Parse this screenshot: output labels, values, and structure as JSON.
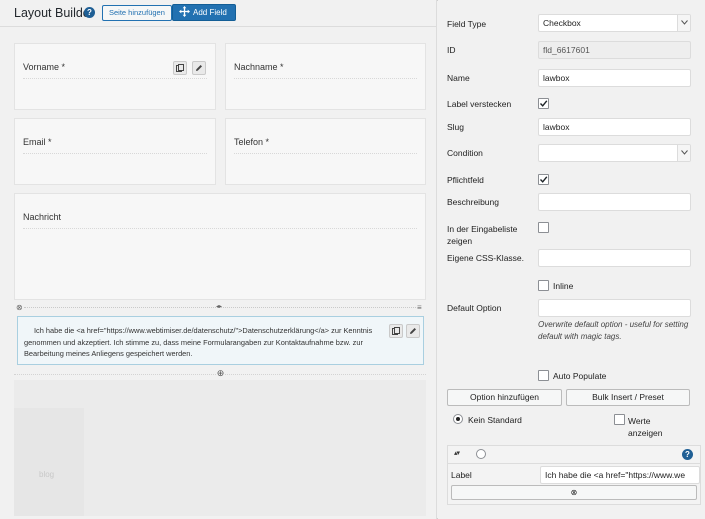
{
  "builder": {
    "title": "Layout Builder",
    "help": "?",
    "add_page_label": "Seite hinzufügen",
    "add_field_label": "Add Field",
    "fields": {
      "vorname": "Vorname *",
      "nachname": "Nachname *",
      "email": "Email *",
      "telefon": "Telefon *",
      "nachricht": "Nachricht"
    },
    "row_bar": {
      "remove": "⊗",
      "resize": "◂▸",
      "menu": "≡"
    },
    "consent_text": "Ich habe die <a href=\"https://www.webtimiser.de/datenschutz/\">Datenschutzerklärung</a> zur Kenntnis genommen und akzeptiert. Ich stimme zu, dass meine Formularangaben zur Kontaktaufnahme bzw. zur Bearbeitung meines Anliegens gespeichert werden.",
    "add_row_icon": "⊕",
    "page_placeholder": "blog"
  },
  "settings": {
    "field_type": {
      "label": "Field Type",
      "value": "Checkbox"
    },
    "id": {
      "label": "ID",
      "value": "fld_6617601"
    },
    "name": {
      "label": "Name",
      "value": "lawbox"
    },
    "hide_label": {
      "label": "Label verstecken",
      "checked": true
    },
    "slug": {
      "label": "Slug",
      "value": "lawbox"
    },
    "condition": {
      "label": "Condition",
      "value": ""
    },
    "required": {
      "label": "Pflichtfeld",
      "checked": true
    },
    "description": {
      "label": "Beschreibung",
      "value": ""
    },
    "entry_list": {
      "label_line1": "In der Eingabeliste",
      "label_line2": "zeigen",
      "checked": false
    },
    "css_class": {
      "label": "Eigene CSS-Klasse.",
      "value": ""
    },
    "inline": {
      "label": "Inline",
      "checked": false
    },
    "default_option": {
      "label": "Default Option",
      "value": "",
      "hint": "Overwrite default option - useful for setting default with magic tags."
    },
    "auto_populate": {
      "label": "Auto Populate",
      "checked": false
    },
    "add_option_label": "Option hinzufügen",
    "bulk_insert_label": "Bulk Insert / Preset",
    "no_default": {
      "label": "Kein Standard",
      "selected": true
    },
    "show_values": {
      "label_line1": "Werte",
      "label_line2": "anzeigen",
      "checked": false
    },
    "option_row": {
      "sort_icon": "▴▾",
      "help": "?",
      "label": "Label",
      "value": "Ich habe die <a href=\"https://www.we",
      "remove_icon": "⊗"
    }
  },
  "colors": {
    "accent": "#2271b1",
    "help_badge": "#1f5f95",
    "consent_bg": "#f0f6f9",
    "consent_border": "#a9cfe0"
  }
}
